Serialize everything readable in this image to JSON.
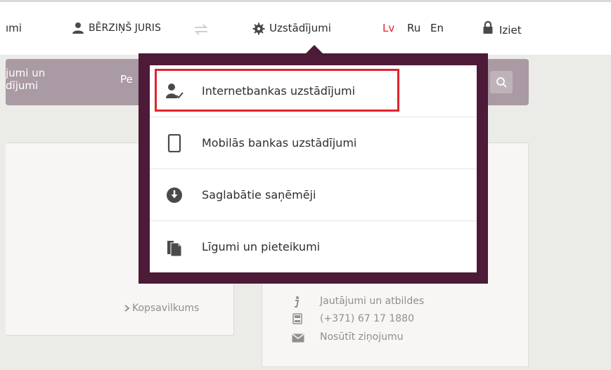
{
  "topbar": {
    "left_fragment": "ımi",
    "user_name": "BĒRZIŅŠ JURIS",
    "settings_label": "Uzstādījumi",
    "languages": [
      "Lv",
      "Ru",
      "En"
    ],
    "logout_label": "Iziet",
    "active_language_color": "#e3232b"
  },
  "navbar": {
    "item1_line1": "jumi un",
    "item1_line2": "dījumi",
    "item2_fragment": "Pe"
  },
  "left_panel": {
    "summary_link": "Kopsavilkums"
  },
  "right_panel": {
    "faq_label": "Jautājumi un atbildes",
    "phone_label": "(+371) 67 17 1880",
    "message_label": "Nosūtīt ziņojumu"
  },
  "dropdown": {
    "items": [
      {
        "label": "Internetbankas uzstādījumi",
        "icon": "user-check-icon"
      },
      {
        "label": "Mobilās bankas uzstādījumi",
        "icon": "mobile-phone-icon"
      },
      {
        "label": "Saglabātie saņēmēji",
        "icon": "download-circle-icon"
      },
      {
        "label": "Līgumi un pieteikumi",
        "icon": "documents-icon"
      }
    ]
  }
}
